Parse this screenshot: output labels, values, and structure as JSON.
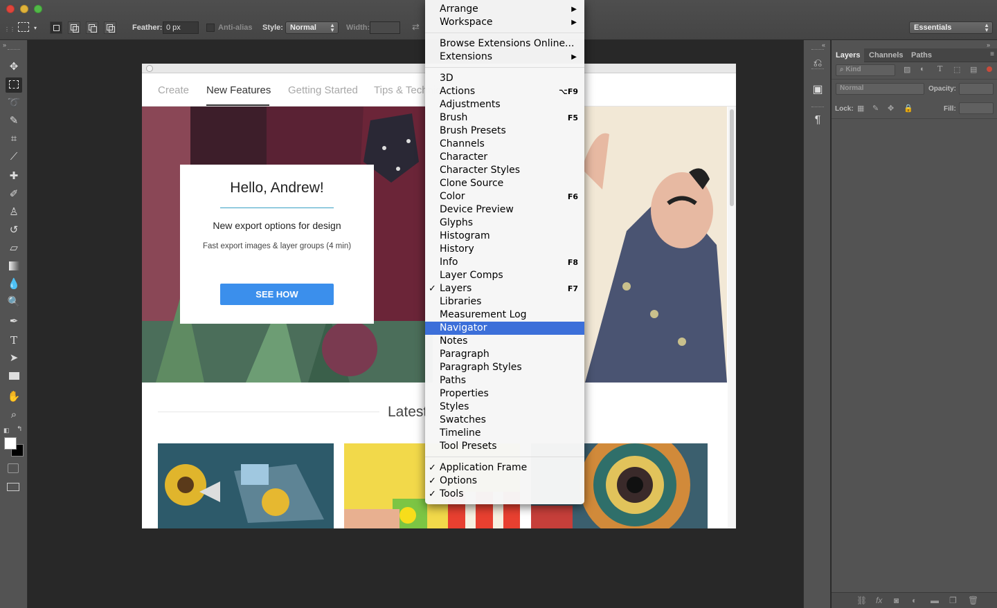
{
  "options_bar": {
    "feather_label": "Feather:",
    "feather_value": "0 px",
    "anti_alias_label": "Anti-alias",
    "style_label": "Style:",
    "style_value": "Normal",
    "width_label": "Width:",
    "workspace_value": "Essentials"
  },
  "start_window": {
    "tabs": [
      "Create",
      "New Features",
      "Getting Started",
      "Tips & Techniques"
    ],
    "active_tab": "New Features",
    "card": {
      "title": "Hello, Andrew!",
      "subtitle": "New export options for design",
      "detail": "Fast export images & layer groups (4 min)",
      "button": "SEE HOW"
    },
    "latest_title": "Latest"
  },
  "layers_panel": {
    "tabs": [
      "Layers",
      "Channels",
      "Paths"
    ],
    "filter_label": "Kind",
    "blend_mode": "Normal",
    "opacity_label": "Opacity:",
    "lock_label": "Lock:",
    "fill_label": "Fill:"
  },
  "window_menu": {
    "items": [
      {
        "label": "Arrange",
        "submenu": true
      },
      {
        "label": "Workspace",
        "submenu": true
      },
      {
        "separator": true
      },
      {
        "label": "Browse Extensions Online..."
      },
      {
        "label": "Extensions",
        "submenu": true
      },
      {
        "separator": true
      },
      {
        "label": "3D"
      },
      {
        "label": "Actions",
        "shortcut": "⌥F9"
      },
      {
        "label": "Adjustments"
      },
      {
        "label": "Brush",
        "shortcut": "F5"
      },
      {
        "label": "Brush Presets"
      },
      {
        "label": "Channels"
      },
      {
        "label": "Character"
      },
      {
        "label": "Character Styles"
      },
      {
        "label": "Clone Source"
      },
      {
        "label": "Color",
        "shortcut": "F6"
      },
      {
        "label": "Device Preview"
      },
      {
        "label": "Glyphs"
      },
      {
        "label": "Histogram"
      },
      {
        "label": "History"
      },
      {
        "label": "Info",
        "shortcut": "F8"
      },
      {
        "label": "Layer Comps"
      },
      {
        "label": "Layers",
        "shortcut": "F7",
        "checked": true
      },
      {
        "label": "Libraries"
      },
      {
        "label": "Measurement Log"
      },
      {
        "label": "Navigator",
        "highlighted": true
      },
      {
        "label": "Notes"
      },
      {
        "label": "Paragraph"
      },
      {
        "label": "Paragraph Styles"
      },
      {
        "label": "Paths"
      },
      {
        "label": "Properties"
      },
      {
        "label": "Styles"
      },
      {
        "label": "Swatches"
      },
      {
        "label": "Timeline"
      },
      {
        "label": "Tool Presets"
      },
      {
        "separator": true
      },
      {
        "label": "Application Frame",
        "checked": true
      },
      {
        "label": "Options",
        "checked": true
      },
      {
        "label": "Tools",
        "checked": true
      }
    ]
  },
  "colors": {
    "menu_highlight": "#3c6fd9",
    "see_how_button": "#3b8fec",
    "accent_rule": "#36a0c4"
  }
}
